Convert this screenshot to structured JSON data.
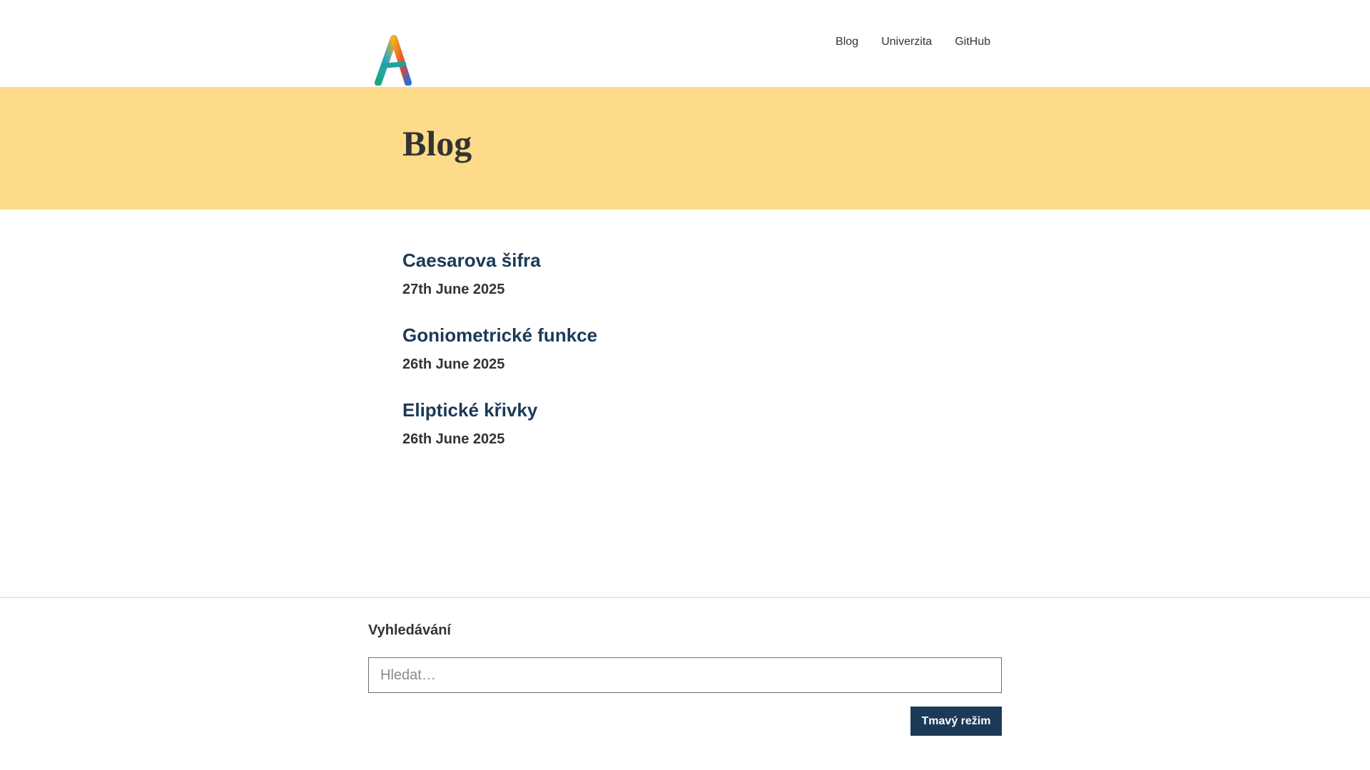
{
  "header": {
    "logo_icon": "a-plus-logo-icon",
    "nav": [
      {
        "label": "Blog"
      },
      {
        "label": "Univerzita"
      },
      {
        "label": "GitHub"
      }
    ]
  },
  "hero": {
    "title": "Blog",
    "background_color": "#fddb8b"
  },
  "posts": [
    {
      "title": "Caesarova šifra",
      "date": "27th June 2025"
    },
    {
      "title": "Goniometrické funkce",
      "date": "26th June 2025"
    },
    {
      "title": "Eliptické křivky",
      "date": "26th June 2025"
    }
  ],
  "footer": {
    "search_label": "Vyhledávání",
    "search_placeholder": "Hledat…",
    "dark_mode_label": "Tmavý režim",
    "button_color": "#1b3a57"
  }
}
